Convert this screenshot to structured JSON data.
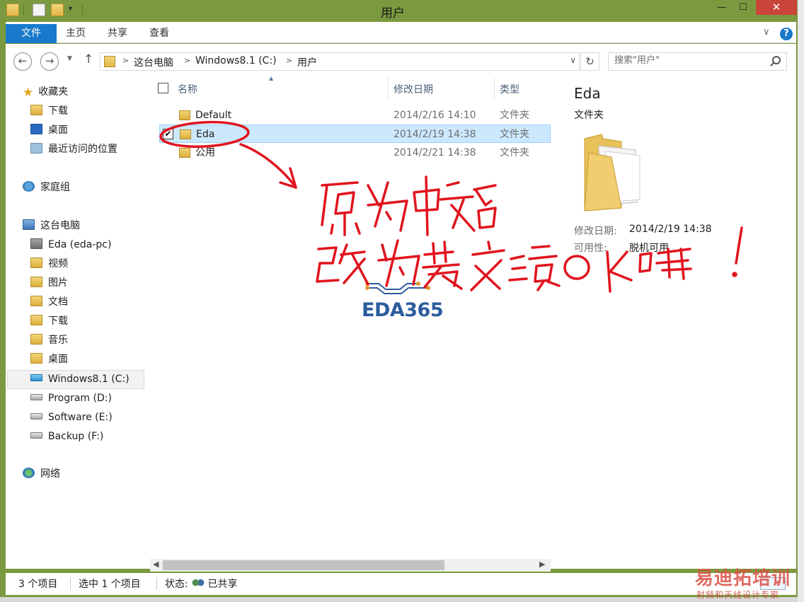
{
  "window": {
    "title": "用户",
    "controls": {
      "minimize": "—",
      "maximize": "☐",
      "close": "✕"
    },
    "quick_access_dropdown": "▾"
  },
  "ribbon": {
    "tabs": [
      {
        "label": "文件"
      },
      {
        "label": "主页"
      },
      {
        "label": "共享"
      },
      {
        "label": "查看"
      }
    ],
    "expand_glyph": "∨",
    "help_glyph": "?"
  },
  "nav": {
    "back_glyph": "←",
    "forward_glyph": "→",
    "dropdown_glyph": "▼",
    "up_glyph": "↑",
    "breadcrumb": [
      "这台电脑",
      "Windows8.1 (C:)",
      "用户"
    ],
    "crumb_sep": ">",
    "address_dropdown_glyph": "∨",
    "refresh_glyph": "↻",
    "search": {
      "placeholder": "搜索\"用户\"",
      "value": ""
    }
  },
  "sidebar": {
    "favorites": {
      "label": "收藏夹",
      "items": [
        {
          "label": "下载",
          "icon": "download-folder-icon"
        },
        {
          "label": "桌面",
          "icon": "desktop-icon"
        },
        {
          "label": "最近访问的位置",
          "icon": "recent-places-icon"
        }
      ]
    },
    "homegroup": {
      "label": "家庭组"
    },
    "this_pc": {
      "label": "这台电脑",
      "items": [
        {
          "label": "Eda (eda-pc)",
          "icon": "user-folder-icon"
        },
        {
          "label": "视频",
          "icon": "videos-folder-icon"
        },
        {
          "label": "图片",
          "icon": "pictures-folder-icon"
        },
        {
          "label": "文档",
          "icon": "documents-folder-icon"
        },
        {
          "label": "下载",
          "icon": "downloads-folder-icon"
        },
        {
          "label": "音乐",
          "icon": "music-folder-icon"
        },
        {
          "label": "桌面",
          "icon": "desktop-folder-icon"
        },
        {
          "label": "Windows8.1 (C:)",
          "icon": "windows-drive-icon",
          "selected": true
        },
        {
          "label": "Program (D:)",
          "icon": "drive-icon"
        },
        {
          "label": "Software (E:)",
          "icon": "drive-icon"
        },
        {
          "label": "Backup (F:)",
          "icon": "drive-icon"
        }
      ]
    },
    "network": {
      "label": "网络"
    }
  },
  "file_list": {
    "columns": {
      "name": "名称",
      "date": "修改日期",
      "type": "类型"
    },
    "rows": [
      {
        "name": "Default",
        "date": "2014/2/16 14:10",
        "type": "文件夹",
        "selected": false
      },
      {
        "name": "Eda",
        "date": "2014/2/19 14:38",
        "type": "文件夹",
        "selected": true,
        "checked": true
      },
      {
        "name": "公用",
        "date": "2014/2/21 14:38",
        "type": "文件夹",
        "selected": false
      }
    ],
    "check_glyph": "✔"
  },
  "details": {
    "name": "Eda",
    "type": "文件夹",
    "modified_label": "修改日期:",
    "modified_value": "2014/2/19 14:38",
    "availability_label": "可用性:",
    "availability_value": "脱机可用"
  },
  "statusbar": {
    "item_count": "3 个项目",
    "selected_count": "选中 1 个项目",
    "state_label": "状态:",
    "state_value": "已共享"
  },
  "annotation": {
    "handwritten_text": "原为中文名 改为英文就OK啦！",
    "color": "#e0141e"
  },
  "logos": {
    "eda": "EDA365",
    "watermark_title": "易迪拓培训",
    "watermark_sub": "射频和天线设计专家"
  },
  "colors": {
    "accent": "#1979ca",
    "window_frame": "#7b9a3f",
    "close_button": "#c9453a",
    "selection": "#cce8ff"
  }
}
